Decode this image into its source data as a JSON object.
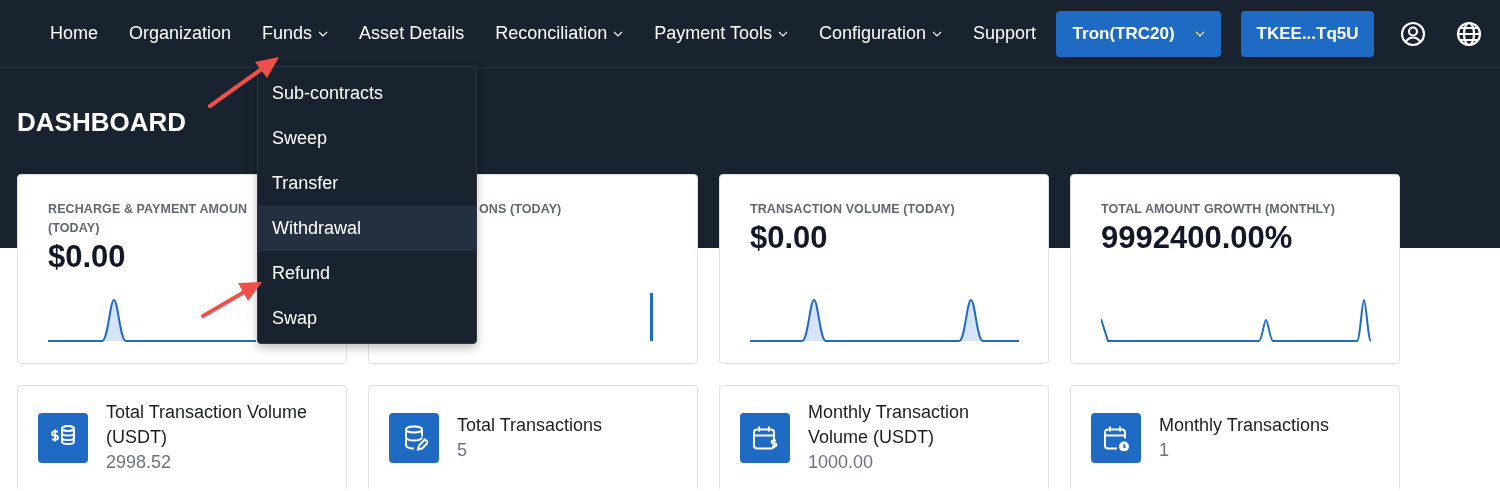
{
  "nav": {
    "items": [
      {
        "label": "Home",
        "dropdown": false
      },
      {
        "label": "Organization",
        "dropdown": false
      },
      {
        "label": "Funds",
        "dropdown": true
      },
      {
        "label": "Asset Details",
        "dropdown": false
      },
      {
        "label": "Reconciliation",
        "dropdown": true
      },
      {
        "label": "Payment Tools",
        "dropdown": true
      },
      {
        "label": "Configuration",
        "dropdown": true
      },
      {
        "label": "Support",
        "dropdown": false
      }
    ],
    "network_button": {
      "label": "Tron(TRC20)"
    },
    "wallet_button": {
      "label": "TKEE...Tq5U"
    }
  },
  "funds_menu": [
    {
      "label": "Sub-contracts",
      "highlighted": false
    },
    {
      "label": "Sweep",
      "highlighted": false
    },
    {
      "label": "Transfer",
      "highlighted": false
    },
    {
      "label": "Withdrawal",
      "highlighted": true
    },
    {
      "label": "Refund",
      "highlighted": false
    },
    {
      "label": "Swap",
      "highlighted": false
    }
  ],
  "page_title": "DASHBOARD",
  "metric_cards": [
    {
      "label": "RECHARGE & PAYMENT AMOUN",
      "label_line_2": "(TODAY)",
      "value": "$0.00"
    },
    {
      "label": "ONS (TODAY)"
    },
    {
      "label": "TRANSACTION VOLUME (TODAY)",
      "value": "$0.00"
    },
    {
      "label": "TOTAL AMOUNT GROWTH (MONTHLY)",
      "value": "9992400.00%"
    }
  ],
  "stat_cards": [
    {
      "title": "Total Transaction Volume (USDT)",
      "value": "2998.52"
    },
    {
      "title": "Total Transactions",
      "value": "5"
    },
    {
      "title": "Monthly Transaction Volume (USDT)",
      "value": "1000.00"
    },
    {
      "title": "Monthly Transactions",
      "value": "1"
    }
  ]
}
